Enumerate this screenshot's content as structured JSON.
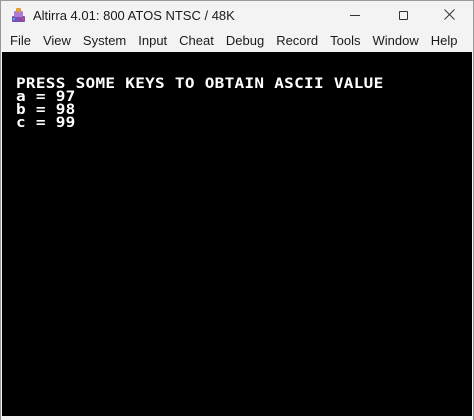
{
  "window": {
    "title": "Altirra 4.01: 800 ATOS NTSC / 48K",
    "icon": "altirra-app-icon",
    "controls": {
      "minimize_icon": "minimize-icon",
      "maximize_icon": "maximize-icon",
      "close_glyph": "✕"
    }
  },
  "menu": {
    "items": [
      {
        "label": "File"
      },
      {
        "label": "View"
      },
      {
        "label": "System"
      },
      {
        "label": "Input"
      },
      {
        "label": "Cheat"
      },
      {
        "label": "Debug"
      },
      {
        "label": "Record"
      },
      {
        "label": "Tools"
      },
      {
        "label": "Window"
      },
      {
        "label": "Help"
      }
    ]
  },
  "screen": {
    "background": "#000000",
    "foreground": "#ffffff",
    "lines": [
      {
        "text": "PRESS SOME KEYS TO OBTAIN ASCII VALUE"
      },
      {
        "text": "a = 97"
      },
      {
        "text": "b = 98"
      },
      {
        "text": "c = 99"
      }
    ]
  }
}
